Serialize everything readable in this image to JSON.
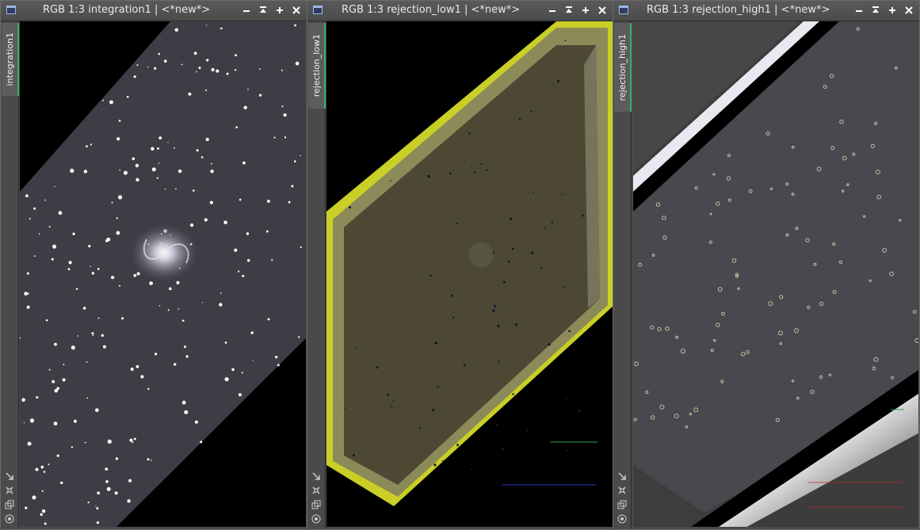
{
  "windows": [
    {
      "title": "RGB 1:3 integration1 | <*new*>",
      "tab_label": "integration1",
      "image_desc": "integration1"
    },
    {
      "title": "RGB 1:3 rejection_low1 | <*new*>",
      "tab_label": "rejection_low1",
      "image_desc": "rejection_low1"
    },
    {
      "title": "RGB 1:3 rejection_high1 | <*new*>",
      "tab_label": "rejection_high1",
      "image_desc": "rejection_high1"
    }
  ],
  "window_buttons": [
    "minimize-icon",
    "shade-icon",
    "maximize-icon",
    "close-icon"
  ],
  "tool_icons": [
    "zoom-to-fit-icon",
    "readout-icon",
    "clone-icon",
    "mask-icon"
  ],
  "colors": {
    "title_bg": "#525252",
    "tab_accent": "#2fb36b",
    "low_rejection_edge": "#d8e01e"
  }
}
